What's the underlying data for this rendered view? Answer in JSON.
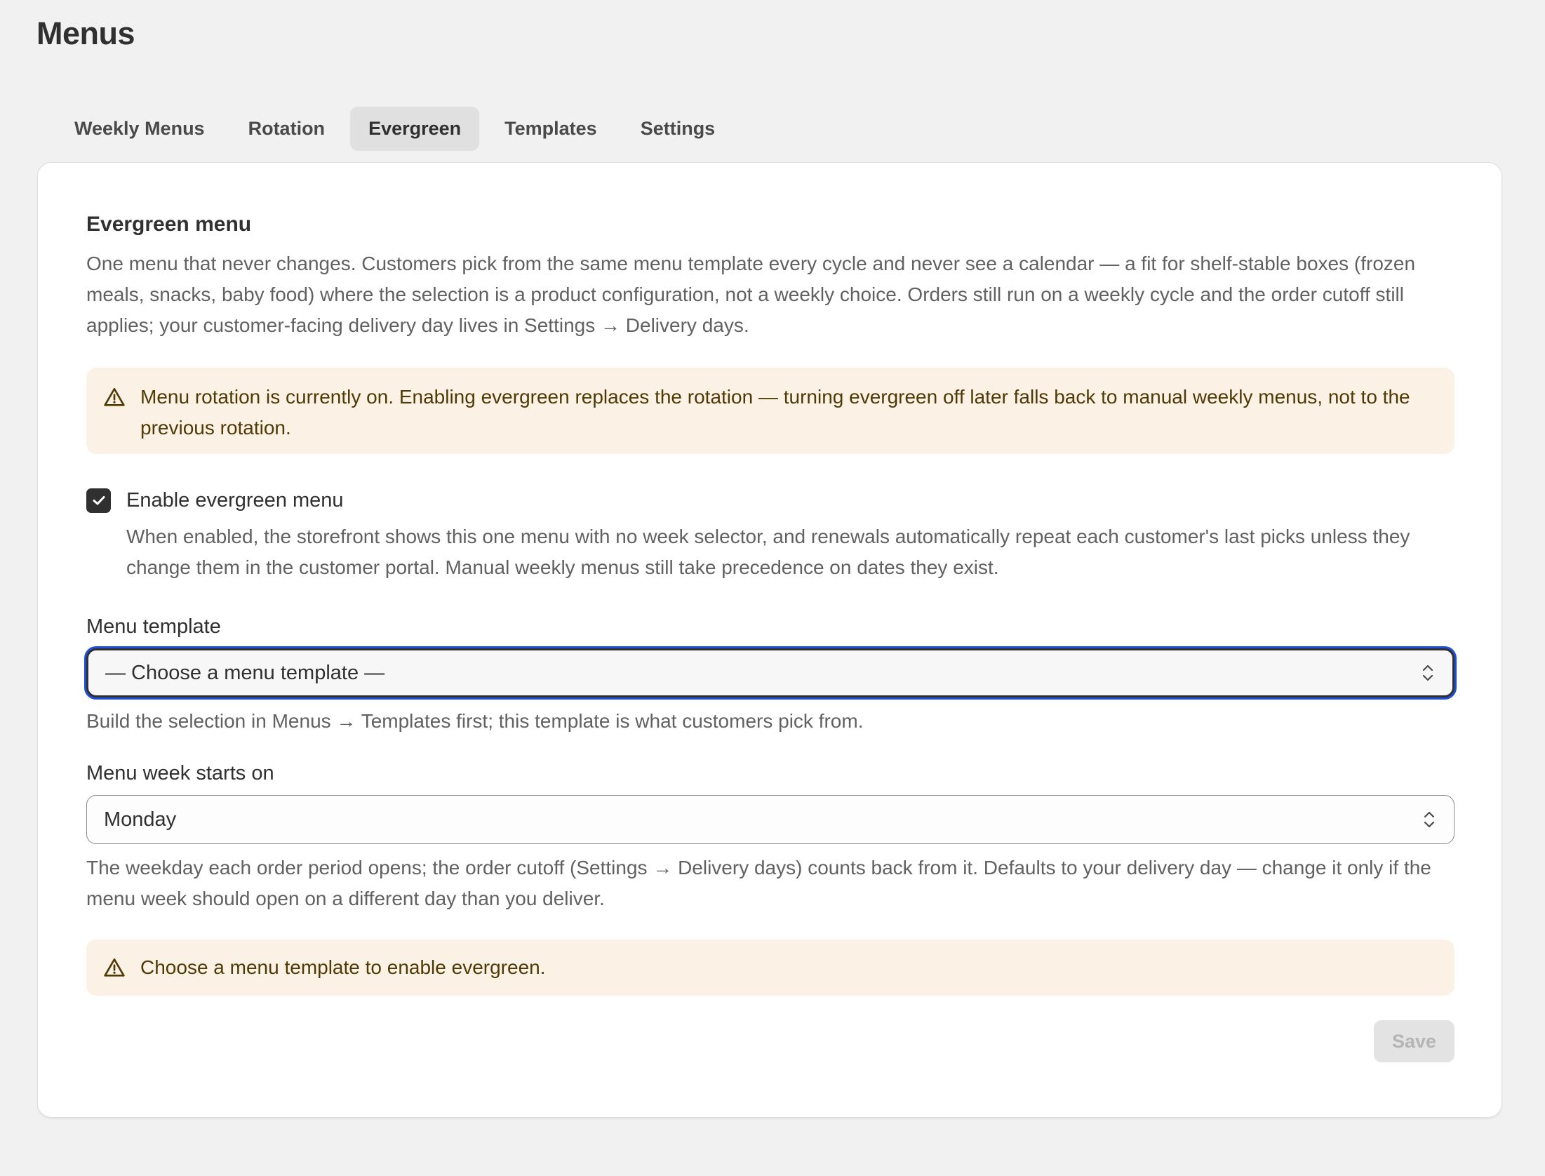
{
  "page": {
    "title": "Menus"
  },
  "tabs": [
    {
      "label": "Weekly Menus",
      "active": false
    },
    {
      "label": "Rotation",
      "active": false
    },
    {
      "label": "Evergreen",
      "active": true
    },
    {
      "label": "Templates",
      "active": false
    },
    {
      "label": "Settings",
      "active": false
    }
  ],
  "evergreen": {
    "title": "Evergreen menu",
    "description": "One menu that never changes. Customers pick from the same menu template every cycle and never see a calendar — a fit for shelf-stable boxes (frozen meals, snacks, baby food) where the selection is a product configuration, not a weekly choice. Orders still run on a weekly cycle and the order cutoff still applies; your customer-facing delivery day lives in Settings → Delivery days.",
    "rotation_warning": "Menu rotation is currently on. Enabling evergreen replaces the rotation — turning evergreen off later falls back to manual weekly menus, not to the previous rotation.",
    "enable_checkbox": {
      "label": "Enable evergreen menu",
      "checked": true,
      "help": "When enabled, the storefront shows this one menu with no week selector, and renewals automatically repeat each customer's last picks unless they change them in the customer portal. Manual weekly menus still take precedence on dates they exist."
    },
    "menu_template": {
      "label": "Menu template",
      "value": "— Choose a menu template —",
      "help": "Build the selection in Menus → Templates first; this template is what customers pick from."
    },
    "week_start": {
      "label": "Menu week starts on",
      "value": "Monday",
      "help": "The weekday each order period opens; the order cutoff (Settings → Delivery days) counts back from it. Defaults to your delivery day — change it only if the menu week should open on a different day than you deliver."
    },
    "template_warning": "Choose a menu template to enable evergreen.",
    "save_label": "Save"
  },
  "colors": {
    "background": "#f1f1f1",
    "card": "#ffffff",
    "warning_bg": "#fcf1e5",
    "warning_text": "#4f3a06",
    "focus_ring": "#1d4fd8",
    "disabled_button": "#e3e3e3"
  },
  "icons": {
    "warning": "alert-triangle-icon",
    "checkmark": "checkmark-icon",
    "select": "select-chevrons-icon"
  }
}
